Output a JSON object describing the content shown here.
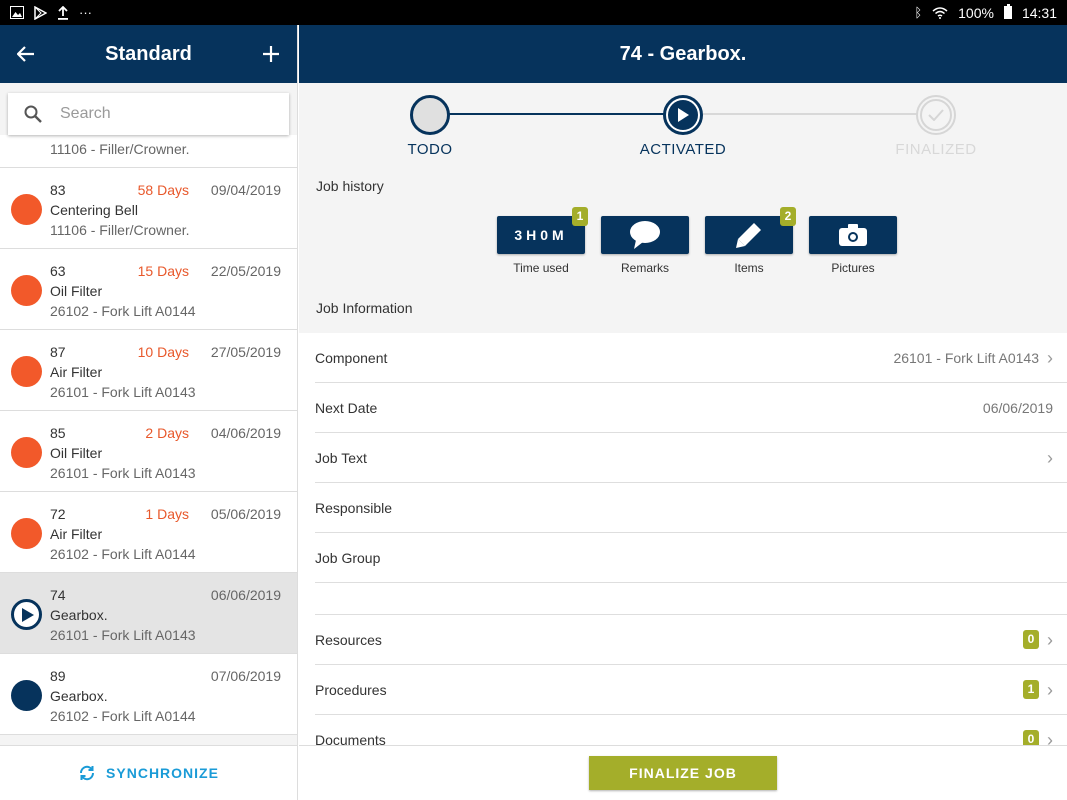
{
  "status_bar": {
    "battery": "100%",
    "time": "14:31",
    "left_icons": [
      "image-icon",
      "play-store-icon",
      "upload-icon",
      "more-dots-icon"
    ],
    "right_icons": [
      "bluetooth-icon",
      "wifi-icon",
      "battery-icon"
    ]
  },
  "left": {
    "title": "Standard",
    "search_placeholder": "Search",
    "partial_item_component": "11106 - Filler/Crowner.",
    "items": [
      {
        "num": "83",
        "days": "58 Days",
        "date": "09/04/2019",
        "name": "Centering Bell",
        "component": "11106 - Filler/Crowner.",
        "state": "overdue"
      },
      {
        "num": "63",
        "days": "15 Days",
        "date": "22/05/2019",
        "name": "Oil Filter",
        "component": "26102 - Fork Lift A0144",
        "state": "overdue"
      },
      {
        "num": "87",
        "days": "10 Days",
        "date": "27/05/2019",
        "name": "Air Filter",
        "component": "26101 - Fork Lift A0143",
        "state": "overdue"
      },
      {
        "num": "85",
        "days": "2 Days",
        "date": "04/06/2019",
        "name": "Oil Filter",
        "component": "26101 - Fork Lift A0143",
        "state": "overdue"
      },
      {
        "num": "72",
        "days": "1 Days",
        "date": "05/06/2019",
        "name": "Air Filter",
        "component": "26102 - Fork Lift A0144",
        "state": "overdue"
      },
      {
        "num": "74",
        "days": "",
        "date": "06/06/2019",
        "name": "Gearbox.",
        "component": "26101 - Fork Lift A0143",
        "state": "active"
      },
      {
        "num": "89",
        "days": "",
        "date": "07/06/2019",
        "name": "Gearbox.",
        "component": "26102 - Fork Lift A0144",
        "state": "upcoming"
      }
    ],
    "sync_label": "SYNCHRONIZE"
  },
  "right": {
    "title": "74 - Gearbox.",
    "steps": [
      "TODO",
      "ACTIVATED",
      "FINALIZED"
    ],
    "job_history_label": "Job history",
    "history": [
      {
        "text": "3H0M",
        "label": "Time used",
        "badge": "1",
        "icon": ""
      },
      {
        "text": "",
        "label": "Remarks",
        "badge": "",
        "icon": "speech-bubble-icon"
      },
      {
        "text": "",
        "label": "Items",
        "badge": "2",
        "icon": "pencil-icon"
      },
      {
        "text": "",
        "label": "Pictures",
        "badge": "",
        "icon": "camera-icon"
      }
    ],
    "job_info_label": "Job Information",
    "info": [
      {
        "key": "Component",
        "value": "26101 - Fork Lift A0143",
        "chevron": true
      },
      {
        "key": "Next Date",
        "value": "06/06/2019",
        "chevron": false
      },
      {
        "key": "Job Text",
        "value": "",
        "chevron": true
      },
      {
        "key": "Responsible",
        "value": "",
        "chevron": false
      },
      {
        "key": "Job Group",
        "value": "",
        "chevron": false
      }
    ],
    "lists": [
      {
        "key": "Resources",
        "count": "0"
      },
      {
        "key": "Procedures",
        "count": "1"
      },
      {
        "key": "Documents",
        "count": "0"
      }
    ],
    "finalize_label": "FINALIZE JOB"
  },
  "colors": {
    "header": "#06335c",
    "overdue": "#f2592a",
    "accent_green": "#a4ae2a",
    "sync_blue": "#1a9bd7"
  }
}
